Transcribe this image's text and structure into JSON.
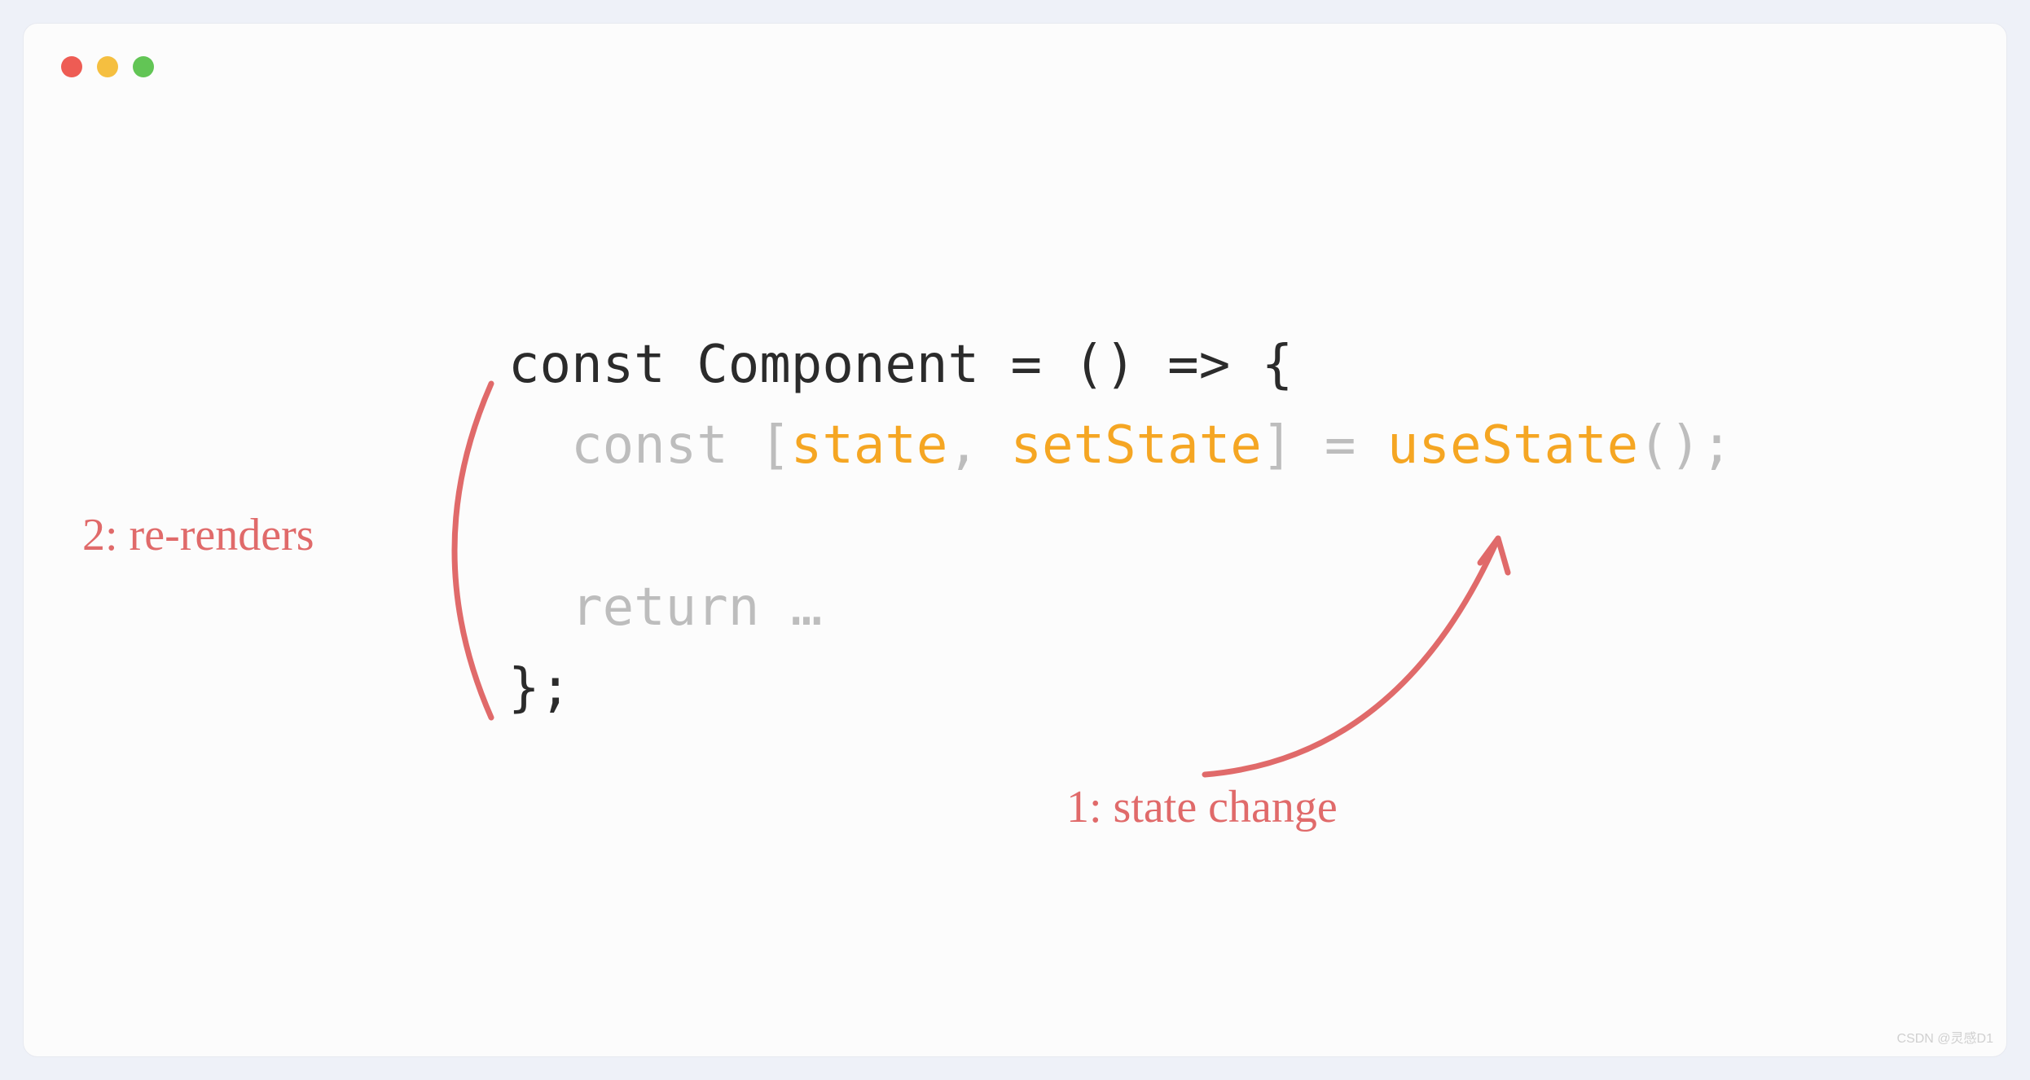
{
  "window": {
    "traffic_lights": [
      "close",
      "minimize",
      "maximize"
    ]
  },
  "code": {
    "line1": {
      "p1": "const Component = () => {"
    },
    "line2": {
      "p1": "  const [",
      "p2": "state",
      "p3": ", ",
      "p4": "setState",
      "p5": "] = ",
      "p6": "useState",
      "p7": "();"
    },
    "line3": "",
    "line4": {
      "p1": "  return …"
    },
    "line5": {
      "p1": "};"
    }
  },
  "annotations": {
    "rerenders": "2: re-renders",
    "state_change": "1: state change"
  },
  "colors": {
    "page_bg": "#eef1f8",
    "window_bg": "#fcfcfc",
    "code_default": "#2b2b2b",
    "code_dim": "#bdbdbd",
    "code_highlight": "#f5a623",
    "annotation": "#e06a6a"
  },
  "watermark": "CSDN @灵感D1"
}
